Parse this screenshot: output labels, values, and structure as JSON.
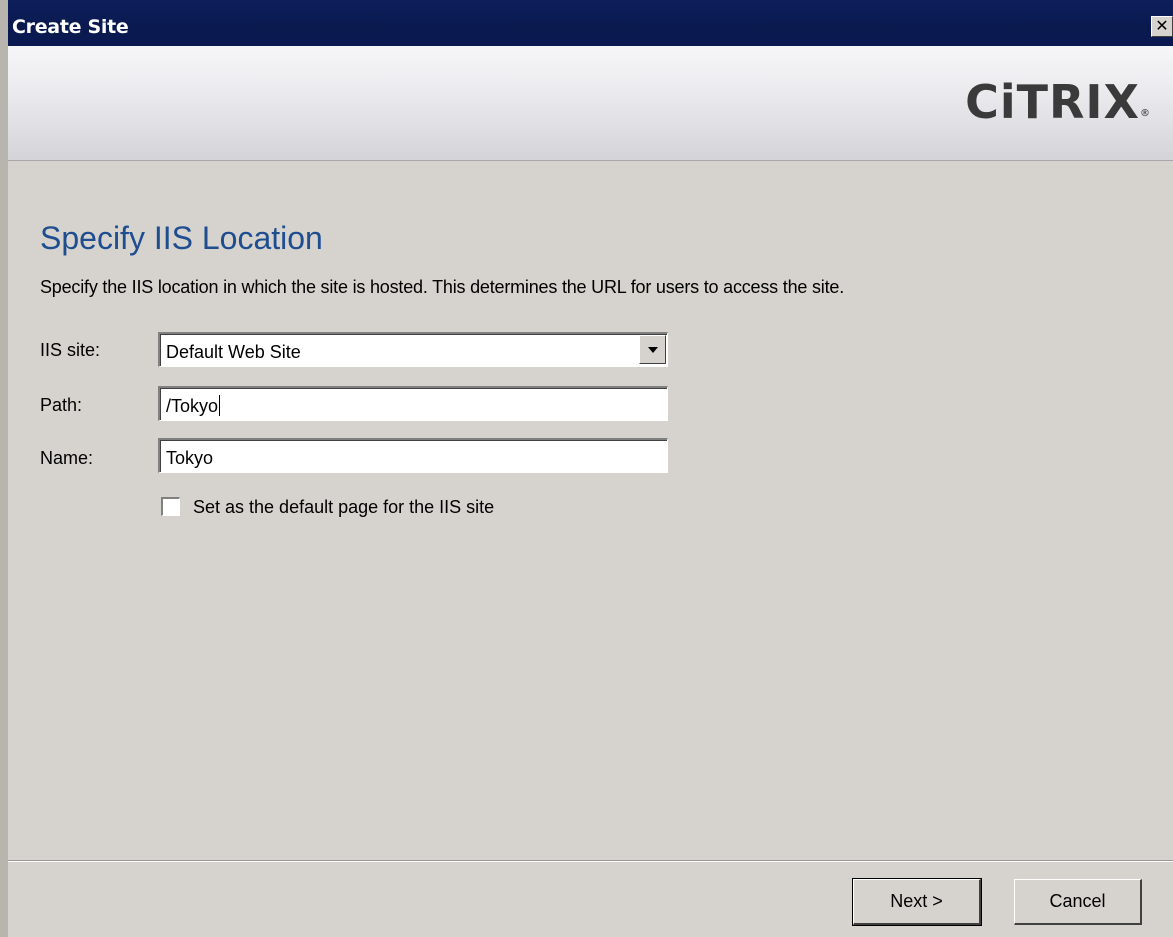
{
  "window": {
    "title": "Create Site",
    "close_glyph": "✕"
  },
  "banner": {
    "logo_text": "CiTRIX",
    "logo_reg": "®"
  },
  "page": {
    "title": "Specify IIS Location",
    "description": "Specify the IIS location in which the site is hosted. This determines the URL for users to access the site."
  },
  "form": {
    "iis_site_label": "IIS site:",
    "iis_site_value": "Default Web Site",
    "path_label": "Path:",
    "path_value": "/Tokyo",
    "name_label": "Name:",
    "name_value": "Tokyo",
    "default_page_label": "Set as the default page for the IIS site",
    "default_page_checked": false
  },
  "footer": {
    "next_label": "Next >",
    "cancel_label": "Cancel"
  },
  "icons": {
    "close": "close-icon",
    "dropdown": "chevron-down-icon"
  }
}
